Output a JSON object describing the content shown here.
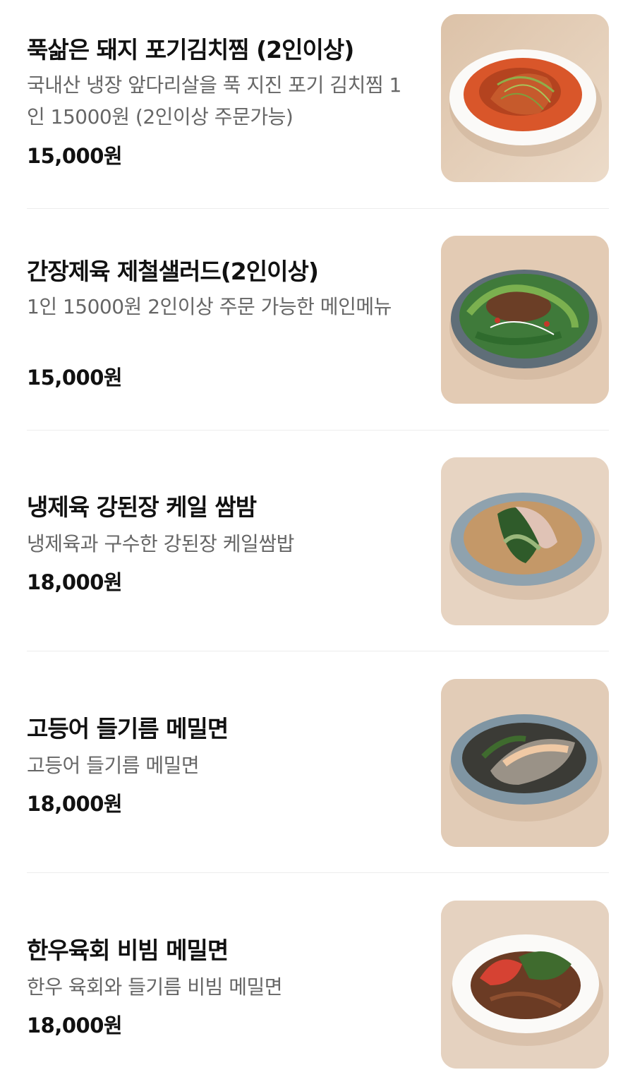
{
  "menu": {
    "items": [
      {
        "name": "푹삶은 돼지 포기김치찜 (2인이상)",
        "description": "국내산 냉장 앞다리살을 푹 지진 포기 김치찜 1인 15000원 (2인이상 주문가능)",
        "price": "15,000원",
        "image": "braised-kimchi-pork-photo"
      },
      {
        "name": "간장제육 제철샐러드(2인이상)",
        "description": "1인 15000원 2인이상 주문 가능한 메인메뉴",
        "price": "15,000원",
        "image": "soy-pork-salad-photo"
      },
      {
        "name": "냉제육 강된장 케일 쌈밤",
        "description": "냉제육과 구수한 강된장 케일쌈밥",
        "price": "18,000원",
        "image": "kale-wrap-rice-photo"
      },
      {
        "name": "고등어 들기름 메밀면",
        "description": "고등어 들기름 메밀면",
        "price": "18,000원",
        "image": "mackerel-buckwheat-noodle-photo"
      },
      {
        "name": "한우육회 비빔 메밀면",
        "description": "한우 육회와 들기름 비빔 메밀면",
        "price": "18,000원",
        "image": "beef-tartare-buckwheat-noodle-photo"
      }
    ]
  }
}
